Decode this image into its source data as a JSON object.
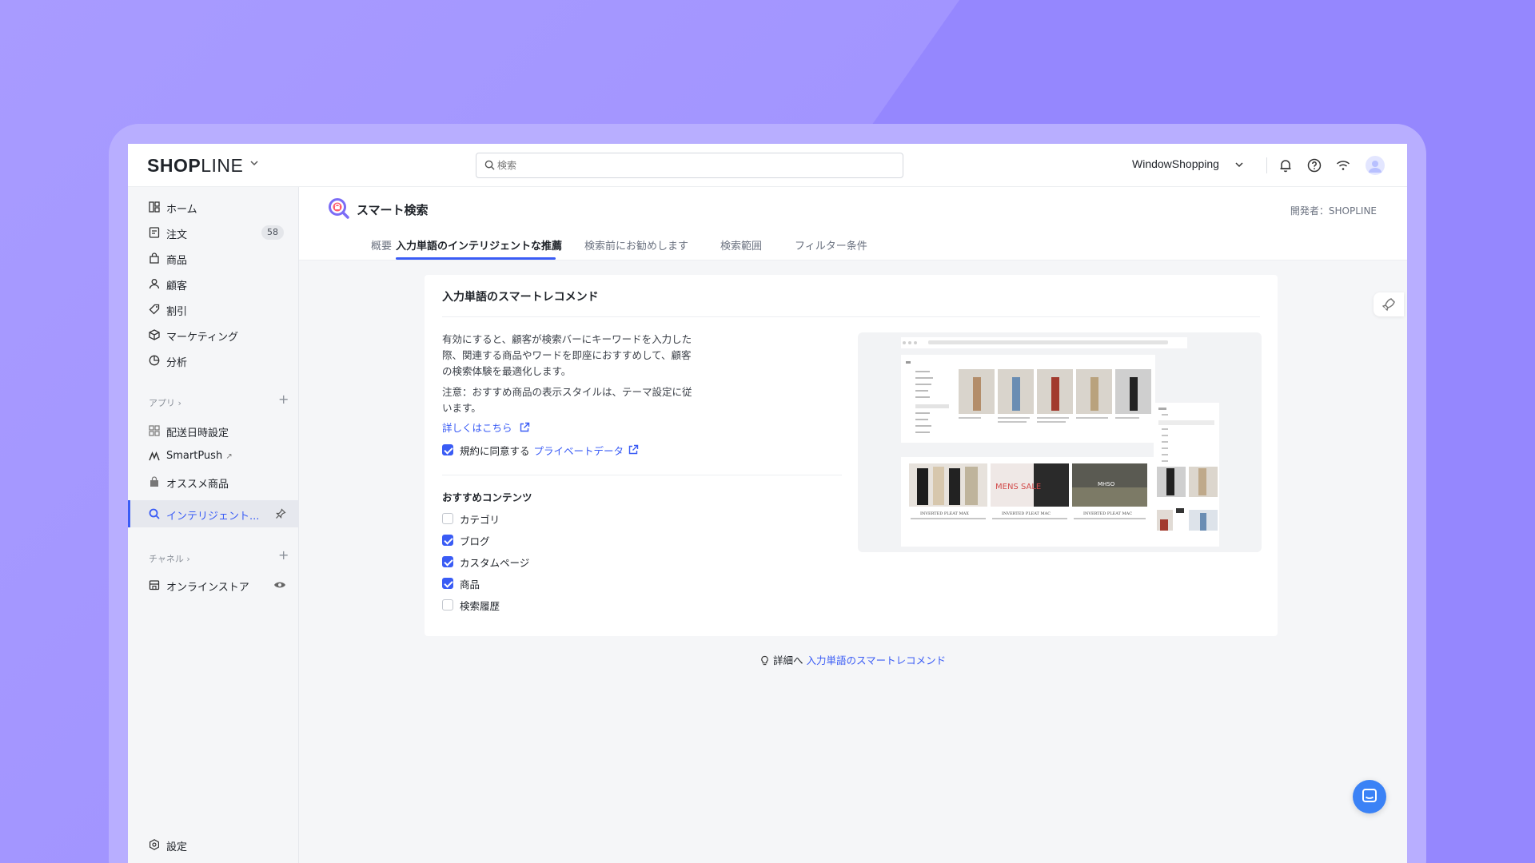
{
  "brand": {
    "logo_bold": "SHOP",
    "logo_rest": "LINE"
  },
  "search": {
    "placeholder": "検索"
  },
  "header": {
    "store_name": "WindowShopping"
  },
  "sidebar": {
    "items": [
      {
        "label": "ホーム"
      },
      {
        "label": "注文",
        "badge": "58"
      },
      {
        "label": "商品"
      },
      {
        "label": "顧客"
      },
      {
        "label": "割引"
      },
      {
        "label": "マーケティング"
      },
      {
        "label": "分析"
      }
    ],
    "apps_title": "アプリ ›",
    "apps": [
      {
        "label": "配送日時設定"
      },
      {
        "label": "SmartPush"
      },
      {
        "label": "オススメ商品"
      }
    ],
    "active_app": "インテリジェント...",
    "channels_title": "チャネル ›",
    "channels": [
      {
        "label": "オンラインストア"
      }
    ],
    "settings": "設定"
  },
  "page": {
    "title": "スマート検索",
    "developer": "開発者：SHOPLINE",
    "tabs": [
      {
        "label": "概要"
      },
      {
        "label": "入力単語のインテリジェントな推薦"
      },
      {
        "label": "検索前にお勧めします"
      },
      {
        "label": "検索範囲"
      },
      {
        "label": "フィルター条件"
      }
    ],
    "active_tab": 1
  },
  "card": {
    "title": "入力単語のスマートレコメンド",
    "desc1_l1": "有効にすると、顧客が検索バーにキーワードを入力した",
    "desc1_l2": "際、関連する商品やワードを即座におすすめして、顧客",
    "desc1_l3": "の検索体験を最適化します。",
    "desc2_l1": "注意：おすすめ商品の表示スタイルは、テーマ設定に従",
    "desc2_l2": "います。",
    "learn_more": "詳しくはこちら",
    "agree_label": "規約に同意する",
    "privacy_link": "プライベートデータ",
    "agree_checked": true,
    "content_title": "おすすめコンテンツ",
    "options": [
      {
        "label": "カテゴリ",
        "checked": false
      },
      {
        "label": "ブログ",
        "checked": true
      },
      {
        "label": "カスタムページ",
        "checked": true
      },
      {
        "label": "商品",
        "checked": true
      },
      {
        "label": "検索履歴",
        "checked": false
      }
    ],
    "preview_banners": [
      "INVERTED PLEAT MAX",
      "INVERTED PLEAT MAC",
      "INVERTED PLEAT MAC"
    ],
    "preview_sale_text": "MENS SALE",
    "preview_brand_text": "MHSO"
  },
  "footer": {
    "prefix": "詳細へ",
    "link": "入力単語のスマートレコメンド"
  },
  "colors": {
    "accent": "#3a5cf5",
    "background": "#a597ff",
    "chat": "#3b82f6"
  }
}
